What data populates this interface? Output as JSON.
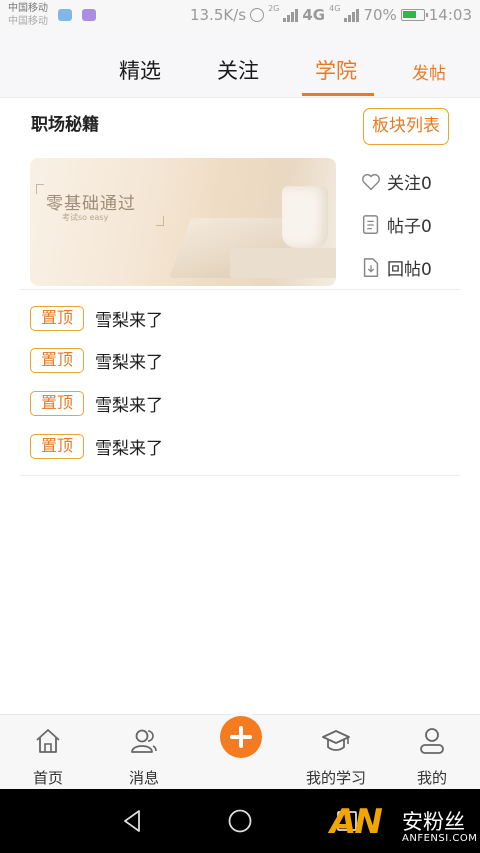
{
  "status_bar": {
    "carrier_1": "中国移动",
    "carrier_2": "中国移动",
    "speed": "13.5K/s",
    "net_2g": "2G",
    "net_4g": "4G",
    "net_4g_small": "4G",
    "battery": "70%",
    "time": "14:03"
  },
  "tabs": [
    {
      "label": "精选",
      "active": false
    },
    {
      "label": "关注",
      "active": false
    },
    {
      "label": "学院",
      "active": true
    }
  ],
  "post_button": "发帖",
  "section": {
    "title": "职场秘籍",
    "board_list_button": "板块列表"
  },
  "banner": {
    "title": "零基础通过",
    "subtitle": "考试so easy"
  },
  "stats": {
    "follow": "关注0",
    "posts": "帖子0",
    "replies": "回帖0"
  },
  "pinned": [
    {
      "badge": "置顶",
      "title": "雪梨来了"
    },
    {
      "badge": "置顶",
      "title": "雪梨来了"
    },
    {
      "badge": "置顶",
      "title": "雪梨来了"
    },
    {
      "badge": "置顶",
      "title": "雪梨来了"
    }
  ],
  "bottom_nav": [
    {
      "label": "首页",
      "icon": "home-icon"
    },
    {
      "label": "消息",
      "icon": "contacts-icon"
    },
    {
      "label": "",
      "icon": "plus-icon"
    },
    {
      "label": "我的学习",
      "icon": "graduation-cap-icon"
    },
    {
      "label": "我的",
      "icon": "user-icon"
    }
  ],
  "watermark": {
    "logo": "AN",
    "cn": "安粉丝",
    "en": "ANFENSI.COM"
  },
  "colors": {
    "accent": "#e87a25",
    "badge_border": "#e8a530",
    "fab": "#f47b20"
  }
}
